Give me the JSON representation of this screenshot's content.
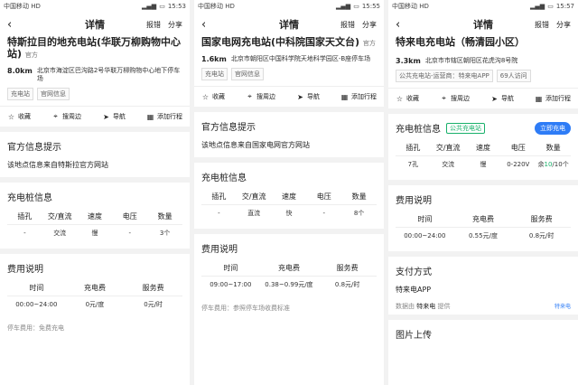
{
  "screens": [
    {
      "status": {
        "carrier": "中国移动",
        "carrier_tag": "HD",
        "time": "15:53"
      },
      "nav": {
        "title": "详情",
        "report": "报错",
        "share": "分享"
      },
      "station": {
        "name": "特斯拉目的地充电站(华联万柳购物中心站)",
        "org": "官方",
        "distance": "8.0km",
        "address": "北京市海淀区巴沟路2号华联万柳购物中心地下停车场",
        "tags": [
          "充电站",
          "官网信息"
        ]
      },
      "actions": {
        "fav": "收藏",
        "nearby": "搜周边",
        "nav": "导航",
        "itinerary": "添加行程"
      },
      "tip": {
        "title": "官方信息提示",
        "text": "该地点信息来自特斯拉官方网站"
      },
      "pile": {
        "title": "充电桩信息",
        "headers": [
          "插孔",
          "交/直流",
          "速度",
          "电压",
          "数量"
        ],
        "row": [
          "-",
          "交流",
          "慢",
          "-",
          "3个"
        ]
      },
      "fee": {
        "title": "费用说明",
        "headers": [
          "时间",
          "充电费",
          "服务费"
        ],
        "row": [
          "00:00~24:00",
          "0元/度",
          "0元/时"
        ]
      },
      "parking": "停车费用：免费充电"
    },
    {
      "status": {
        "carrier": "中国移动",
        "carrier_tag": "HD",
        "time": "15:55"
      },
      "nav": {
        "title": "详情",
        "report": "报错",
        "share": "分享"
      },
      "station": {
        "name": "国家电网充电站(中科院国家天文台)",
        "org": "官方",
        "distance": "1.6km",
        "address": "北京市朝阳区中国科学院天地科学园区-B座停车场",
        "tags": [
          "充电站",
          "官网信息"
        ]
      },
      "actions": {
        "fav": "收藏",
        "nearby": "搜周边",
        "nav": "导航",
        "itinerary": "添加行程"
      },
      "tip": {
        "title": "官方信息提示",
        "text": "该地点信息来自国家电网官方网站"
      },
      "pile": {
        "title": "充电桩信息",
        "headers": [
          "插孔",
          "交/直流",
          "速度",
          "电压",
          "数量"
        ],
        "row": [
          "-",
          "直流",
          "快",
          "-",
          "8个"
        ]
      },
      "fee": {
        "title": "费用说明",
        "headers": [
          "时间",
          "充电费",
          "服务费"
        ],
        "row": [
          "09:00~17:00",
          "0.38~0.99元/度",
          "0.8元/时"
        ]
      },
      "parking": "停车费用：参照停车场收费标准"
    },
    {
      "status": {
        "carrier": "中国移动",
        "carrier_tag": "HD",
        "time": "15:57"
      },
      "nav": {
        "title": "详情",
        "report": "报错",
        "share": "分享"
      },
      "station": {
        "name": "特来电充电站（畅清园小区）",
        "distance": "3.3km",
        "address": "北京市市辖区朝阳区花虎沟8号院",
        "tags": [
          "公共充电站-运营商：特来电APP",
          "69人访问"
        ]
      },
      "actions": {
        "fav": "收藏",
        "nearby": "搜周边",
        "nav": "导航",
        "itinerary": "添加行程"
      },
      "pile": {
        "title": "充电桩信息",
        "badge": "公共充电站",
        "button": "立即充电",
        "headers": [
          "插孔",
          "交/直流",
          "速度",
          "电压",
          "数量"
        ],
        "row": [
          "7孔",
          "交流",
          "慢",
          "0-220V"
        ],
        "count_prefix": "余",
        "count_free": "10",
        "count_suffix": "/10个"
      },
      "fee": {
        "title": "费用说明",
        "headers": [
          "时间",
          "充电费",
          "服务费"
        ],
        "row": [
          "00:00~24:00",
          "0.55元/度",
          "0.8元/时"
        ]
      },
      "pay": {
        "title": "支付方式",
        "app": "特来电APP"
      },
      "source": {
        "prefix": "数据由",
        "name": "特来电",
        "suffix": "提供",
        "logo_text": "特来电"
      },
      "photo": {
        "title": "图片上传"
      }
    }
  ]
}
